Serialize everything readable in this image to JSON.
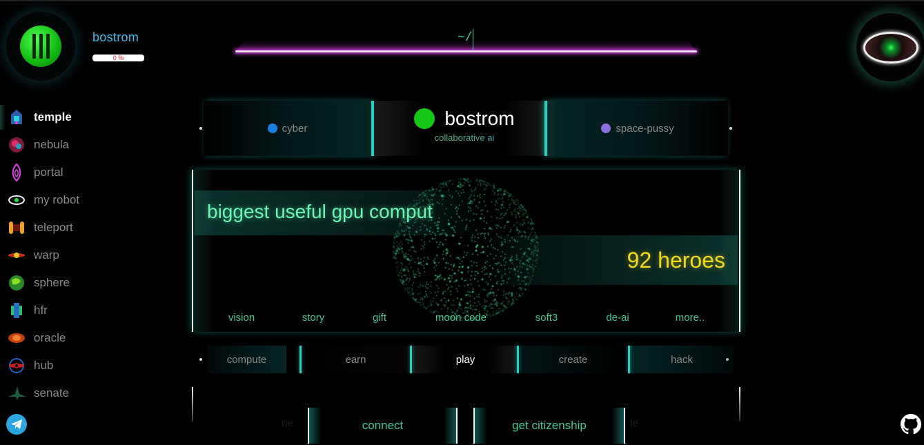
{
  "header": {
    "network_name": "bostrom",
    "progress_label": "0 %",
    "progress_value": 0,
    "command_text": "~/"
  },
  "sidebar": {
    "items": [
      {
        "label": "temple",
        "icon": "temple-icon",
        "active": true
      },
      {
        "label": "nebula",
        "icon": "nebula-icon"
      },
      {
        "label": "portal",
        "icon": "portal-icon"
      },
      {
        "label": "my robot",
        "icon": "robot-eye-icon"
      },
      {
        "label": "teleport",
        "icon": "teleport-icon"
      },
      {
        "label": "warp",
        "icon": "warp-icon"
      },
      {
        "label": "sphere",
        "icon": "sphere-icon"
      },
      {
        "label": "hfr",
        "icon": "hfr-icon"
      },
      {
        "label": "oracle",
        "icon": "oracle-icon"
      },
      {
        "label": "hub",
        "icon": "hub-icon"
      },
      {
        "label": "senate",
        "icon": "senate-icon"
      }
    ]
  },
  "networks": {
    "left": {
      "label": "cyber",
      "color": "#1a7fe0"
    },
    "current": {
      "label": "bostrom",
      "subtitle": "collaborative ai",
      "color": "#16c816"
    },
    "right": {
      "label": "space-pussy",
      "color": "#8c6fe0"
    }
  },
  "panel": {
    "headline": "biggest useful gpu comput",
    "heroes": "92 heroes",
    "links": [
      "vision",
      "story",
      "gift",
      "moon code",
      "soft3",
      "de-ai",
      "more.."
    ]
  },
  "tabs": {
    "items": [
      "compute",
      "earn",
      "play",
      "create",
      "hack"
    ],
    "active": "play"
  },
  "bottom": {
    "buttons": [
      "connect",
      "get citizenship"
    ],
    "faded_left": "ne",
    "faded_right": "le"
  },
  "colors": {
    "accent_cyan": "#1ed2c6",
    "link_green": "#3fc99a",
    "heroes_yellow": "#f0d81c",
    "cmd_magenta": "#c23ed0"
  }
}
